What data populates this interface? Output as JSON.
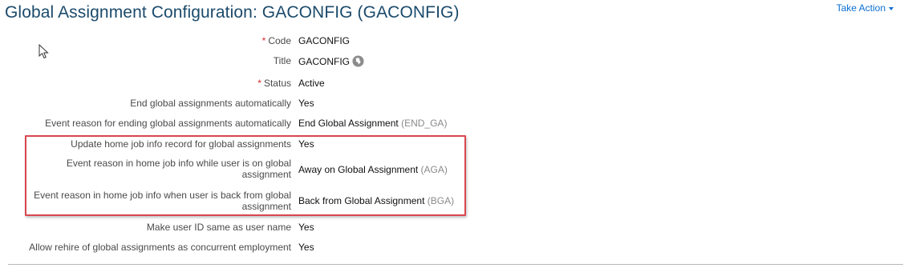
{
  "header": {
    "title": "Global Assignment Configuration: GACONFIG (GACONFIG)",
    "take_action_label": "Take Action"
  },
  "fields": [
    {
      "label": "Code",
      "required": "*",
      "value": "GACONFIG",
      "code": ""
    },
    {
      "label": "Title",
      "required": "",
      "value": "GACONFIG",
      "code": "",
      "icon": "globe-icon"
    },
    {
      "label": "Status",
      "required": "*",
      "value": "Active",
      "code": ""
    },
    {
      "label": "End global assignments automatically",
      "required": "",
      "value": "Yes",
      "code": ""
    },
    {
      "label": "Event reason for ending global assignments automatically",
      "required": "",
      "value": "End Global Assignment",
      "code": "(END_GA)"
    },
    {
      "label": "Update home job info record for global assignments",
      "required": "",
      "value": "Yes",
      "code": ""
    },
    {
      "label": "Event reason in home job info while user is on global assignment",
      "required": "",
      "value": "Away on Global Assignment",
      "code": "(AGA)"
    },
    {
      "label": "Event reason in home job info when user is back from global assignment",
      "required": "",
      "value": "Back from Global Assignment",
      "code": "(BGA)"
    },
    {
      "label": "Make user ID same as user name",
      "required": "",
      "value": "Yes",
      "code": ""
    },
    {
      "label": "Allow rehire of global assignments as concurrent employment",
      "required": "",
      "value": "Yes",
      "code": ""
    }
  ],
  "colors": {
    "title": "#1b4a6b",
    "link": "#0a6ed1",
    "required": "#d9262c",
    "highlight": "#d9474f"
  }
}
